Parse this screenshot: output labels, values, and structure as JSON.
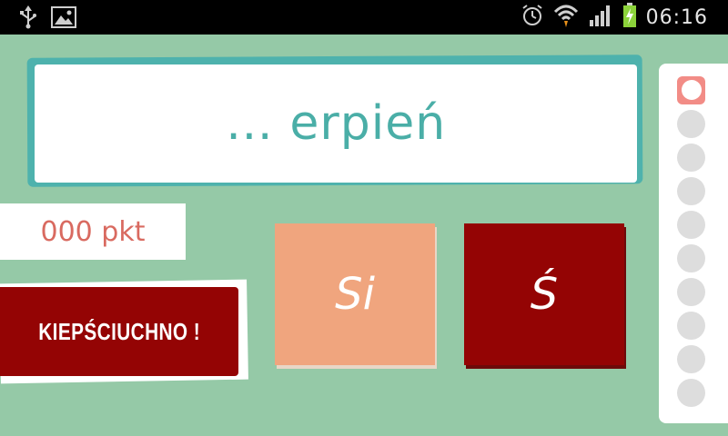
{
  "status_bar": {
    "time": "06:16",
    "icons_left": [
      "usb-icon",
      "image-icon"
    ],
    "icons_right": [
      "alarm-icon",
      "wifi-icon",
      "signal-icon",
      "battery-charging-icon"
    ]
  },
  "game": {
    "word": "… erpień",
    "score": "000 pkt",
    "feedback": "KIEPŚCIUCHNO !",
    "choices": [
      "Si",
      "Ś"
    ],
    "progress": {
      "total": 10,
      "current": 1
    }
  },
  "colors": {
    "background": "#95c9a7",
    "teal": "#4aaea7",
    "dark_red": "#940404",
    "peach": "#f0a57e",
    "score_text": "#d96a60"
  }
}
